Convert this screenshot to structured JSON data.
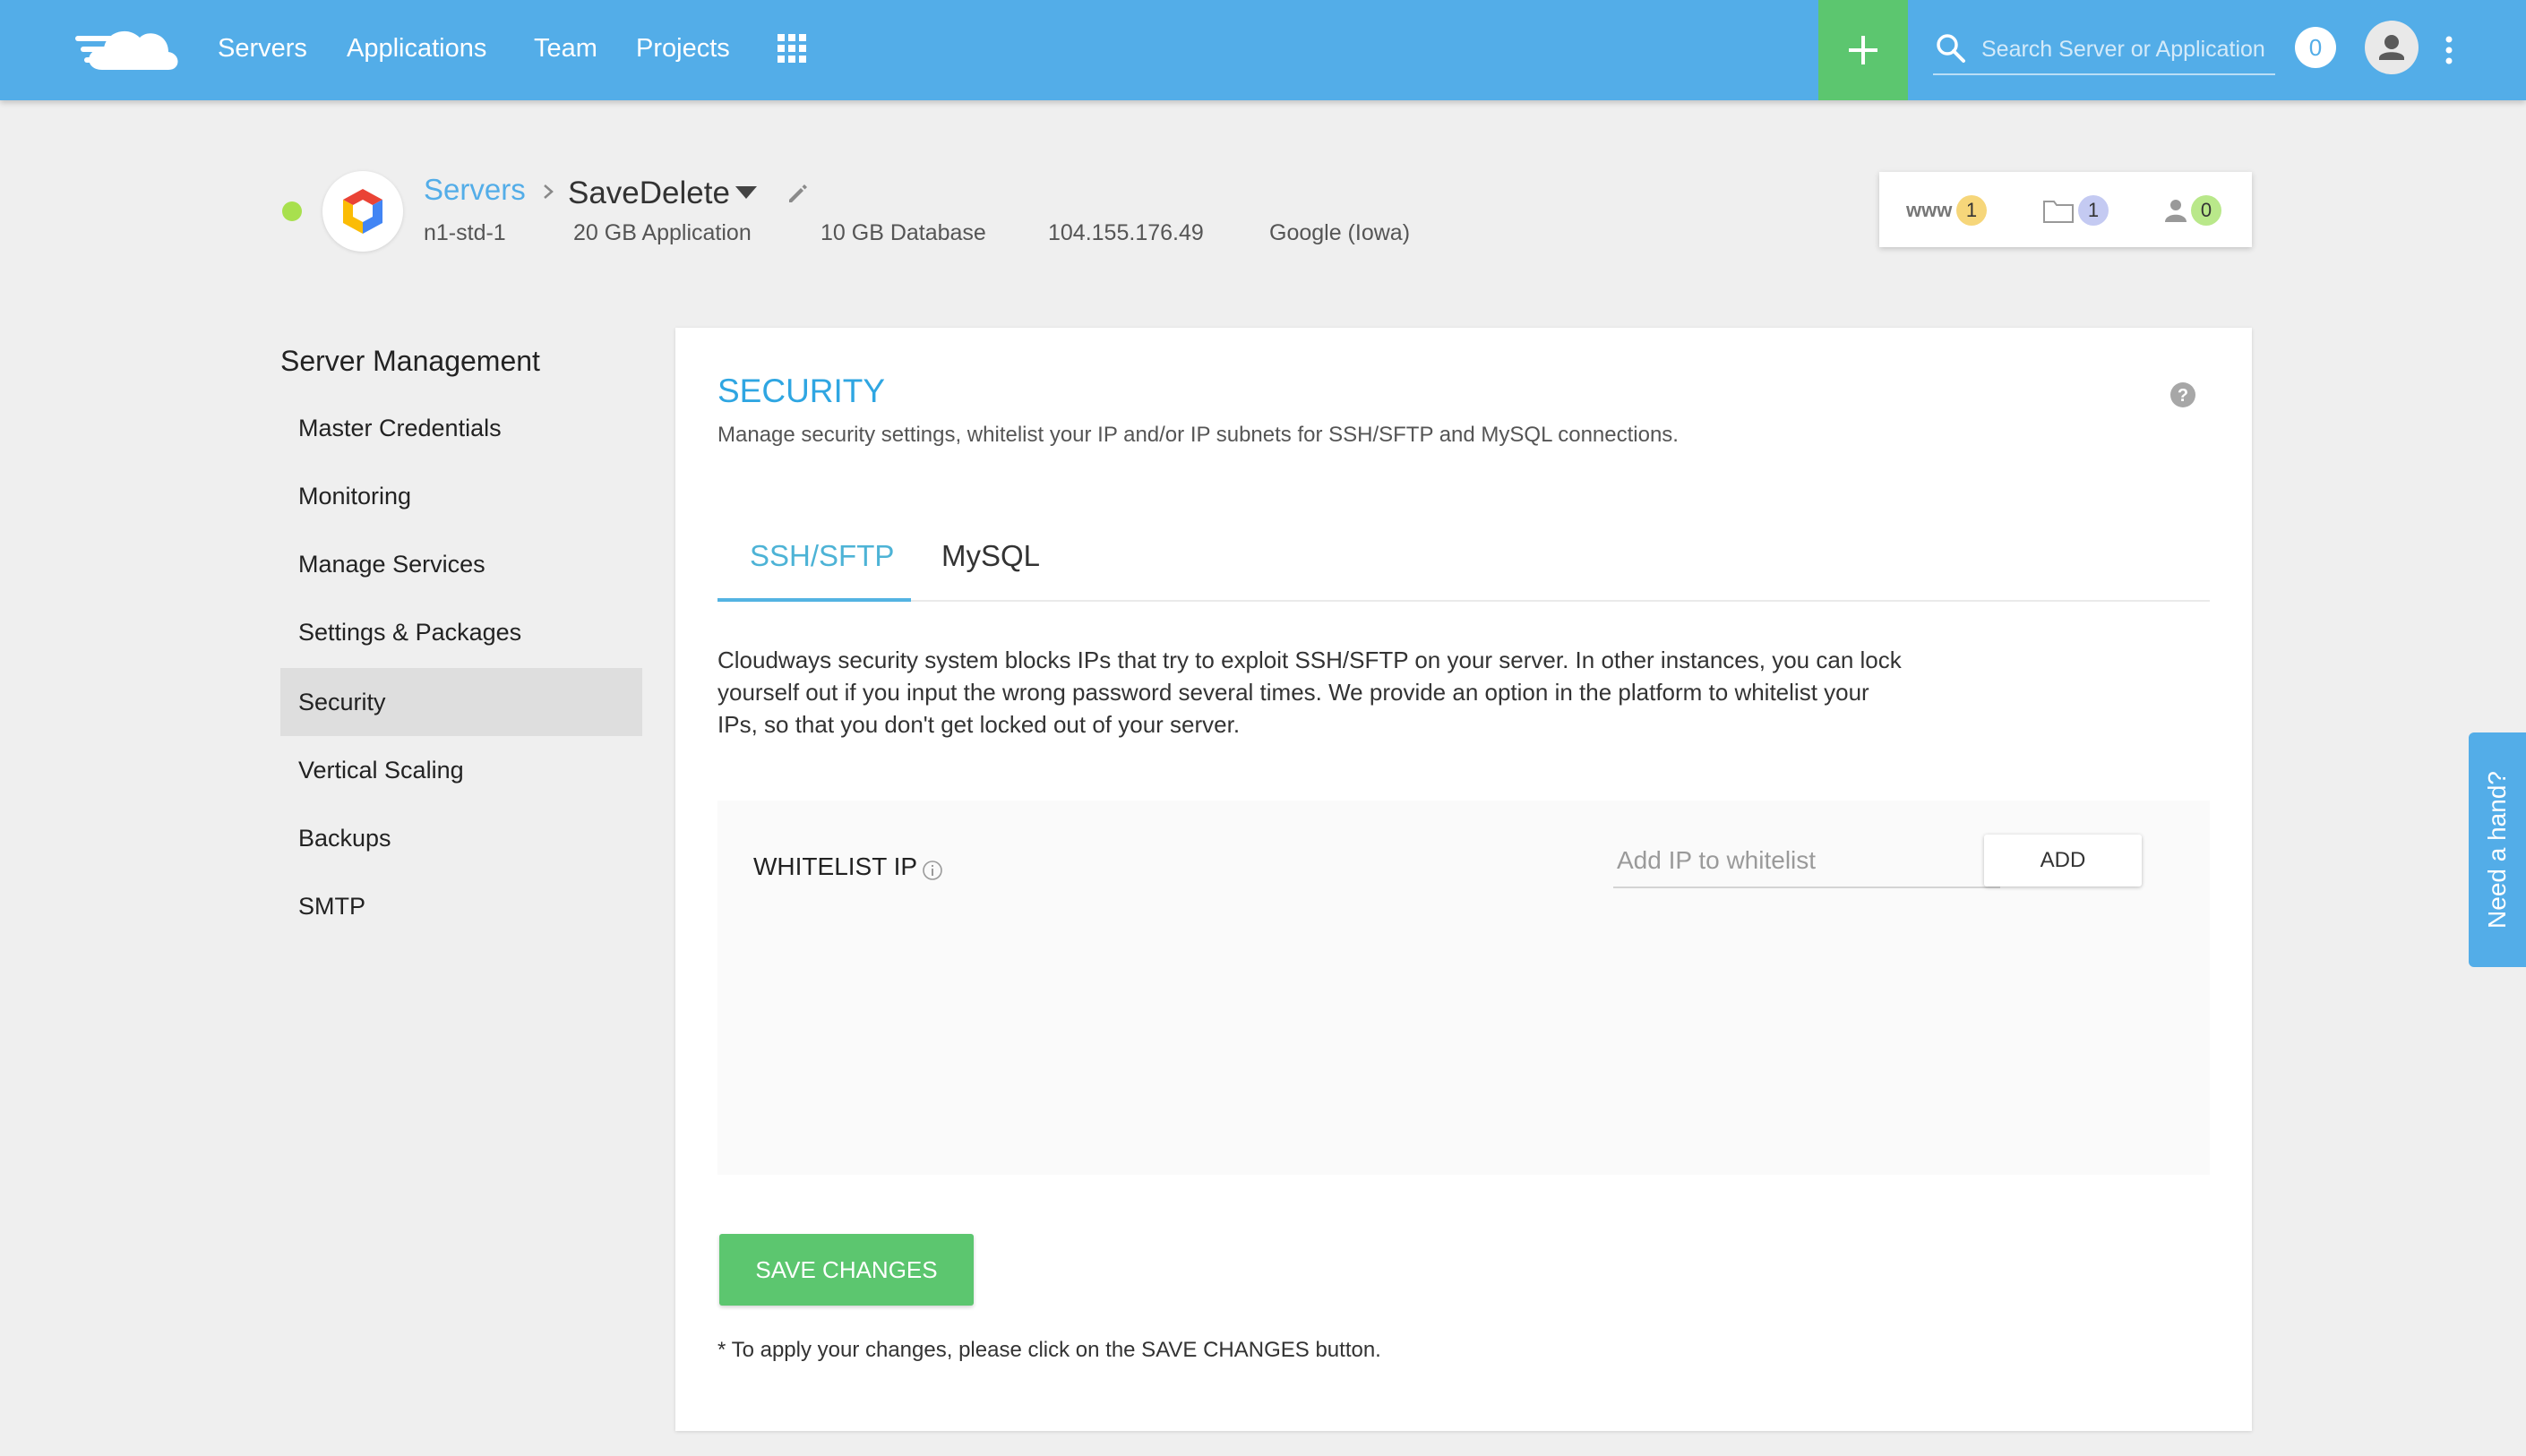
{
  "nav": {
    "links": [
      "Servers",
      "Applications",
      "Team",
      "Projects"
    ],
    "search_placeholder": "Search Server or Application",
    "notification_count": "0"
  },
  "server": {
    "breadcrumb_root": "Servers",
    "name": "SaveDelete",
    "meta": [
      "n1-std-1",
      "20 GB Application",
      "10 GB Database",
      "104.155.176.49",
      "Google (Iowa)"
    ],
    "stats": {
      "www_label": "www",
      "www_count": "1",
      "folder_count": "1",
      "user_count": "0"
    }
  },
  "sidebar": {
    "heading": "Server Management",
    "items": [
      "Master Credentials",
      "Monitoring",
      "Manage Services",
      "Settings & Packages",
      "Security",
      "Vertical Scaling",
      "Backups",
      "SMTP"
    ],
    "active": "Security"
  },
  "panel": {
    "title": "SECURITY",
    "description": "Manage security settings, whitelist your IP and/or IP subnets for SSH/SFTP and MySQL connections.",
    "tabs": [
      "SSH/SFTP",
      "MySQL"
    ],
    "intro": "Cloudways security system blocks IPs that try to exploit SSH/SFTP on your server. In other instances, you can lock yourself out if you input the wrong password several times. We provide an option in the platform to whitelist your IPs, so that you don't get locked out of your server.",
    "whitelist_label": "WHITELIST IP",
    "whitelist_placeholder": "Add IP to whitelist",
    "add_label": "ADD",
    "save_label": "SAVE CHANGES",
    "save_note": "* To apply your changes, please click on the SAVE CHANGES button."
  },
  "help_tab": "Need a hand?",
  "colors": {
    "topbar": "#53ade8",
    "add_button": "#5cc66f",
    "accent": "#2fa6e2",
    "status_online": "#a8e04e",
    "save_button": "#5cc66f"
  }
}
